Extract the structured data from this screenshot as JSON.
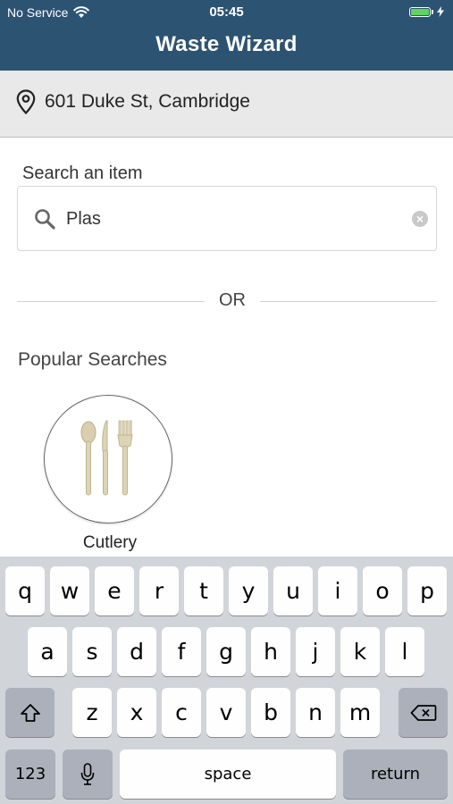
{
  "status_bar": {
    "carrier": "No Service",
    "time": "05:45",
    "wifi_icon": "wifi-icon",
    "battery_icon": "battery-icon",
    "battery_level": 1.0
  },
  "header": {
    "title": "Waste Wizard"
  },
  "location": {
    "icon": "location-pin-icon",
    "address": "601 Duke St, Cambridge"
  },
  "search": {
    "label": "Search an item",
    "value": "Plas",
    "search_icon": "search-icon",
    "clear_icon": "clear-icon"
  },
  "divider": {
    "text": "OR"
  },
  "popular": {
    "title": "Popular Searches",
    "items": [
      {
        "label": "Cutlery",
        "icon": "cutlery-icon"
      }
    ]
  },
  "keyboard": {
    "row1": [
      "q",
      "w",
      "e",
      "r",
      "t",
      "y",
      "u",
      "i",
      "o",
      "p"
    ],
    "row2": [
      "a",
      "s",
      "d",
      "f",
      "g",
      "h",
      "j",
      "k",
      "l"
    ],
    "row3": [
      "z",
      "x",
      "c",
      "v",
      "b",
      "n",
      "m"
    ],
    "shift_icon": "shift-icon",
    "backspace_icon": "backspace-icon",
    "numbers_label": "123",
    "mic_icon": "microphone-icon",
    "space_label": "space",
    "return_label": "return"
  },
  "colors": {
    "header_bg": "#2d5373",
    "location_bg": "#e9e9e9",
    "keyboard_bg": "#d1d4d9",
    "battery_fill": "#5fd35b"
  }
}
